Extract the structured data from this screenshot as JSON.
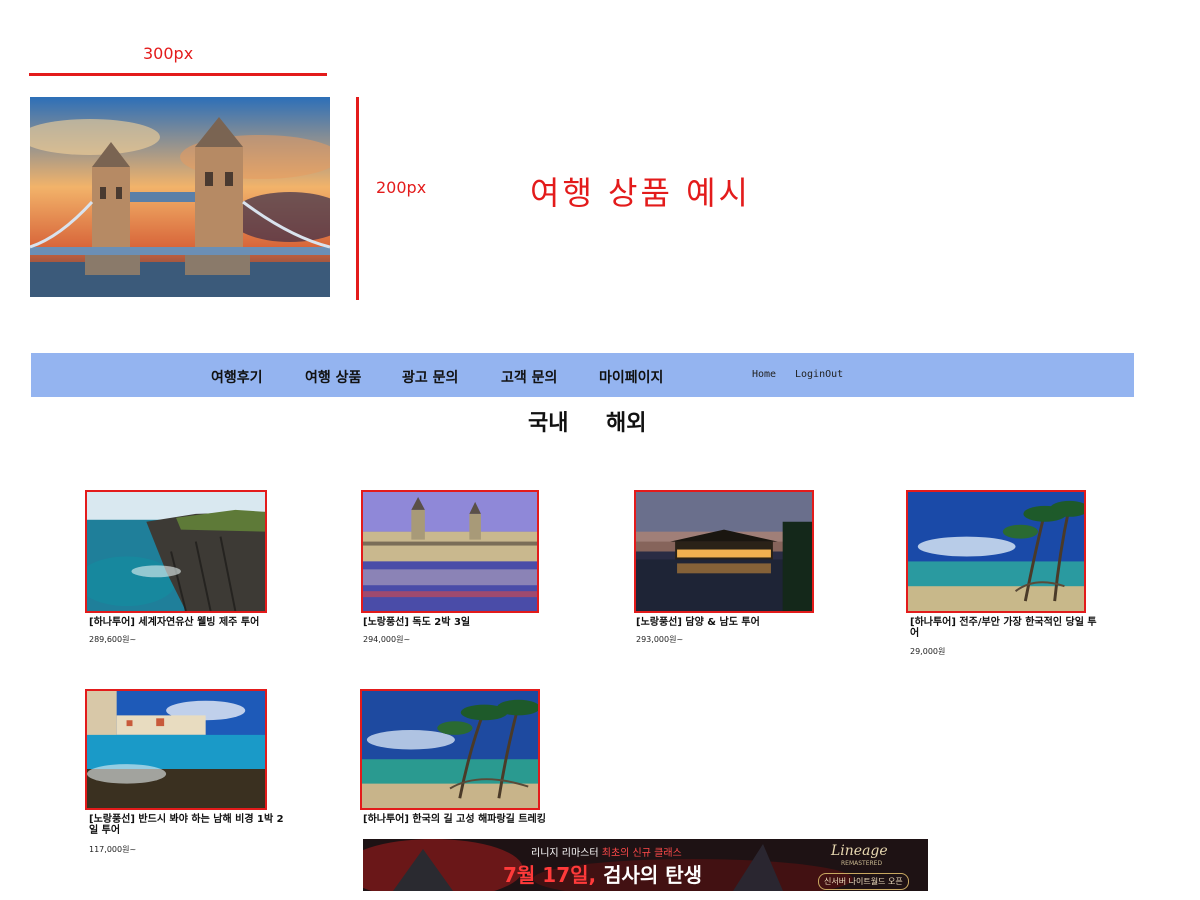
{
  "example": {
    "width_label": "300px",
    "height_label": "200px",
    "title": "여행 상품 예시"
  },
  "nav": {
    "items": [
      "여행후기",
      "여행 상품",
      "광고 문의",
      "고객 문의",
      "마이페이지"
    ],
    "home": "Home",
    "login": "LoginOut"
  },
  "region_tabs": [
    "국내",
    "해외"
  ],
  "products": [
    {
      "title": "[하나투어] 세계자연유산 웰빙 제주 투어",
      "price": "289,600원~"
    },
    {
      "title": "[노랑풍선] 독도 2박 3일",
      "price": "294,000원~"
    },
    {
      "title": "[노랑풍선] 담양 & 남도 투어",
      "price": "293,000원~"
    },
    {
      "title": "[하나투어] 전주/부안 가장 한국적인 당일 투어",
      "price": "29,000원"
    },
    {
      "title": "[노랑풍선] 반드시 봐야 하는 남해 비경 1박 2일 투어",
      "price": "117,000원~"
    },
    {
      "title": "[하나투어] 한국의 길 고성 해파랑길 트레킹",
      "price": ""
    }
  ],
  "banner": {
    "line1_a": "리니지 리마스터",
    "line1_b": "최초의 신규 클래스",
    "line2_a": "7월 17일,",
    "line2_b": "검사의 탄생",
    "logo": "Lineage",
    "logo_sub": "REMASTERED",
    "cta": "신서버 나이트월드 오픈"
  },
  "colors": {
    "accent_red": "#e31b1b",
    "nav_bg": "#94b4f0"
  }
}
